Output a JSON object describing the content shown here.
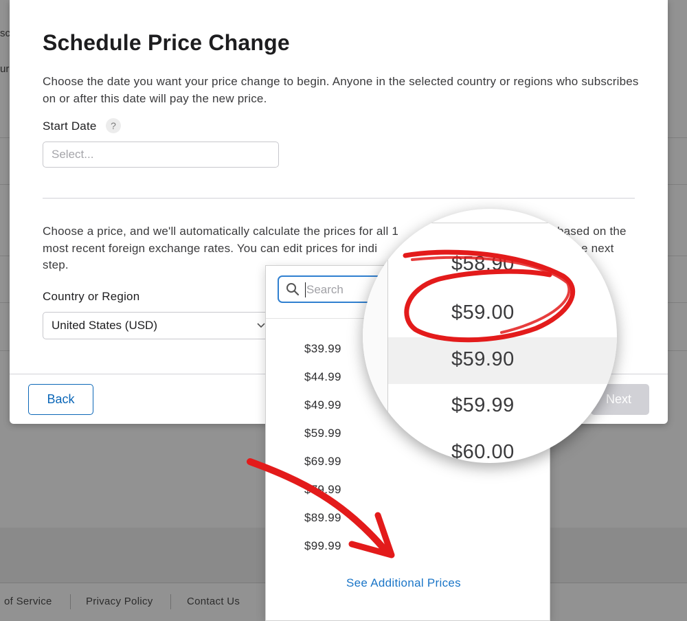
{
  "background": {
    "clipped_text": [
      "sc",
      "ur"
    ],
    "footer_links": [
      "of Service",
      "Privacy Policy",
      "Contact Us"
    ]
  },
  "modal": {
    "title": "Schedule Price Change",
    "intro": "Choose the date you want your price change to begin. Anyone in the selected country or regions who subscribes on or after this date will pay the new price.",
    "start_date_label": "Start Date",
    "help_symbol": "?",
    "start_date_placeholder": "Select...",
    "price_line1": "Choose a price, and we'll automatically calculate the prices for all 1",
    "price_line1_end": "based on the",
    "price_line2": "most recent foreign exchange rates. You can edit prices for indi",
    "price_line2_end": "e next",
    "price_line3": "step.",
    "country_label": "Country or Region",
    "country_value": "United States (USD)",
    "back_label": "Back",
    "next_label": "Next"
  },
  "dropdown": {
    "search_placeholder": "Search",
    "prices": [
      "$39.99",
      "$44.99",
      "$49.99",
      "$59.99",
      "$69.99",
      "$79.99",
      "$89.99",
      "$99.99"
    ],
    "more_link": "See Additional Prices"
  },
  "magnifier": {
    "prices": [
      "$58.90",
      "$59.00",
      "$59.90",
      "$59.99",
      "$60.00"
    ],
    "highlighted": "$59.90",
    "circled": "$59.00"
  },
  "colors": {
    "accent": "#0a66b7",
    "annotation": "#e31b1b",
    "overlay": "#929292"
  },
  "icons": [
    "search-icon",
    "chevron-down-icon",
    "help-icon"
  ]
}
